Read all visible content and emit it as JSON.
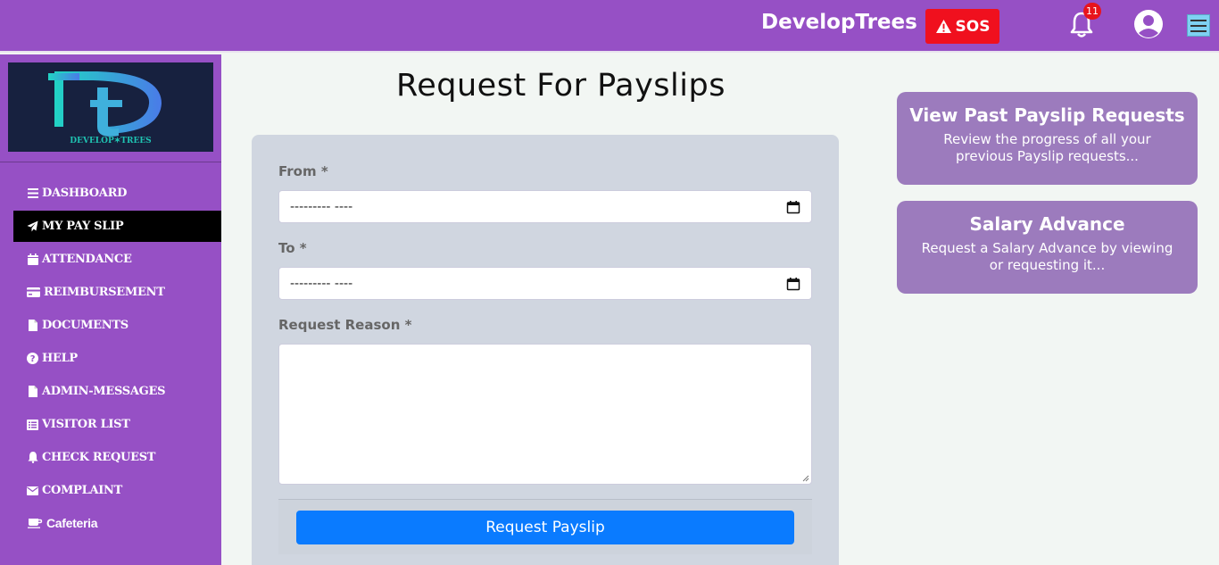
{
  "header": {
    "brand": "DevelopTrees",
    "sos_label": "SOS",
    "notification_count": "11"
  },
  "sidebar": {
    "logo_text": "DEVELOP TREES",
    "items": [
      {
        "label": "DASHBOARD",
        "icon": "bars-icon"
      },
      {
        "label": "MY PAY SLIP",
        "icon": "paper-plane-icon",
        "active": true
      },
      {
        "label": "ATTENDANCE",
        "icon": "calendar-icon"
      },
      {
        "label": "REIMBURSEMENT",
        "icon": "credit-card-icon"
      },
      {
        "label": "DOCUMENTS",
        "icon": "file-icon"
      },
      {
        "label": "HELP",
        "icon": "question-circle-icon"
      },
      {
        "label": "ADMIN-MESSAGES",
        "icon": "file-icon"
      },
      {
        "label": "VISITOR LIST",
        "icon": "list-icon"
      },
      {
        "label": "CHECK REQUEST",
        "icon": "bell-icon"
      },
      {
        "label": "COMPLAINT",
        "icon": "envelope-icon"
      },
      {
        "label": "Cafeteria",
        "icon": "coffee-icon"
      }
    ]
  },
  "main": {
    "title": "Request For Payslips",
    "from_label": "From *",
    "from_value": "--------- ----",
    "to_label": "To *",
    "to_value": "--------- ----",
    "reason_label": "Request Reason *",
    "submit_label": "Request Payslip"
  },
  "cards": [
    {
      "title": "View Past Payslip Requests",
      "desc": "Review the progress of all your previous Payslip requests..."
    },
    {
      "title": "Salary Advance",
      "desc": "Request a Salary Advance by viewing or requesting it..."
    }
  ],
  "colors": {
    "topbar": "#9650c5",
    "sos": "#f0101e",
    "primary_button": "#0a7bff",
    "card": "#9c7bbd"
  }
}
